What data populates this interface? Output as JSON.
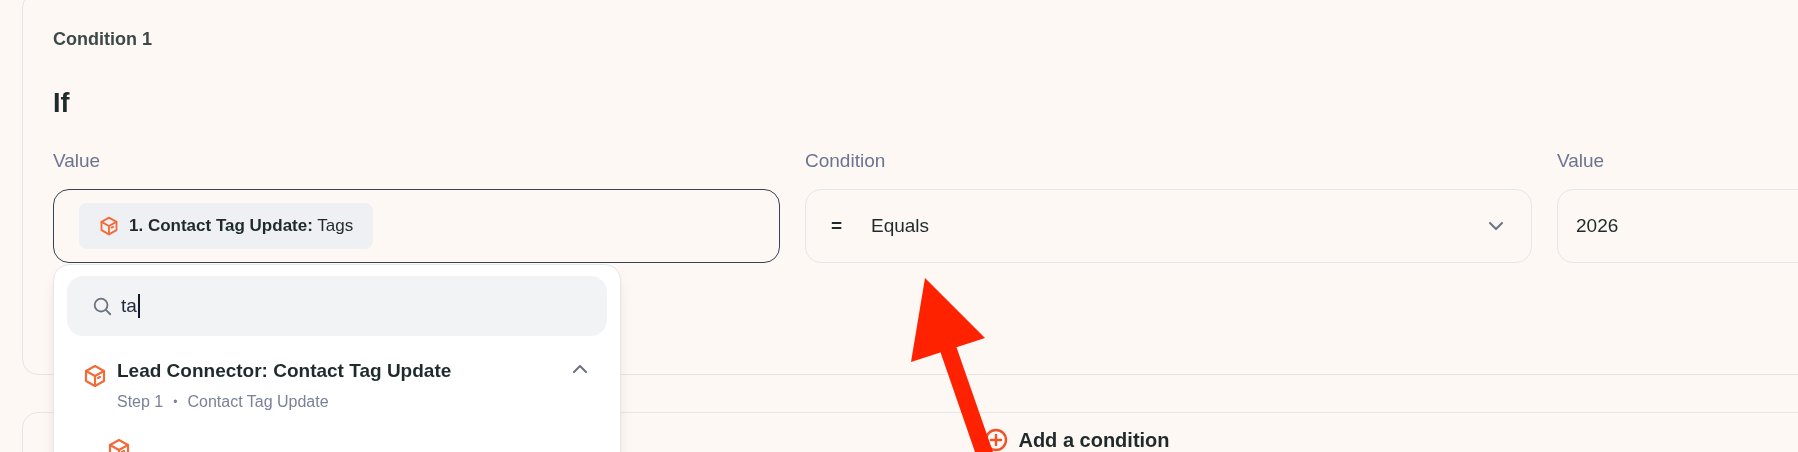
{
  "condition_card": {
    "title": "Condition 1",
    "heading": "If",
    "fields": [
      {
        "kind": "token",
        "label": "Value",
        "token": "**1. Contact Tag Update:** Tags",
        "focused": true
      },
      {
        "kind": "select",
        "label": "Condition",
        "symbol": "=",
        "value": "Equals",
        "focused": false
      },
      {
        "kind": "text",
        "label": "Value",
        "value": "2026",
        "focused": false
      }
    ]
  },
  "dropdown": {
    "search": {
      "value": "ta"
    },
    "groups": [
      {
        "title": "Lead Connector: Contact Tag Update",
        "step": "Step 1",
        "separator": "•",
        "subtitle": "Contact Tag Update",
        "expanded": true
      }
    ]
  },
  "add_condition": {
    "label": "Add a condition"
  }
}
